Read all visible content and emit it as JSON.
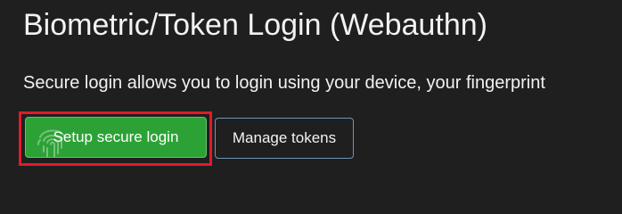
{
  "page": {
    "title": "Biometric/Token Login (Webauthn)",
    "description": "Secure login allows you to login using your device, your fingerprint"
  },
  "actions": {
    "setup_label": "Setup secure login",
    "setup_icon": "fingerprint-icon",
    "manage_label": "Manage tokens"
  },
  "colors": {
    "background": "#1f1f1f",
    "primary_button": "#2ca236",
    "secondary_border": "#6e95b8",
    "highlight_border": "#e01b2b"
  }
}
